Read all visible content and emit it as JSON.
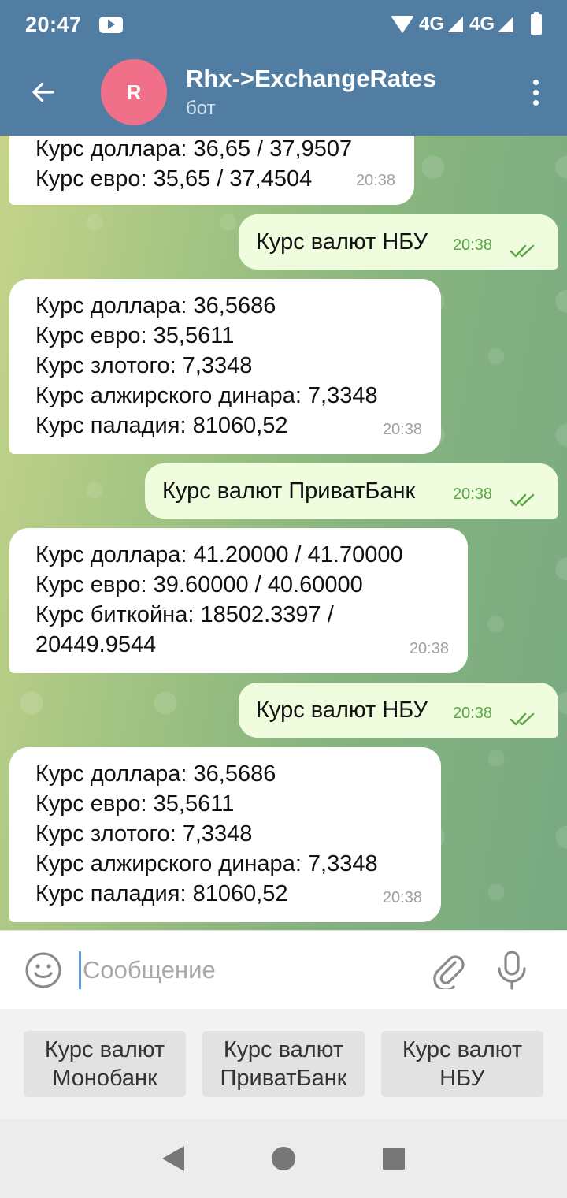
{
  "status_bar": {
    "time": "20:47",
    "network_1": "4G",
    "network_2": "4G",
    "icons": [
      "youtube-icon",
      "wifi-icon",
      "signal-icon",
      "battery-icon"
    ]
  },
  "header": {
    "avatar_letter": "R",
    "title": "Rhx->ExchangeRates",
    "subtitle": "бот",
    "avatar_color": "#f0708a",
    "bar_color": "#527da3"
  },
  "messages": [
    {
      "direction": "in",
      "lines": [
        "Курс доллара: 36,65 / 37,9507",
        "Курс евро: 35,65 / 37,4504"
      ],
      "time": "20:38"
    },
    {
      "direction": "out",
      "lines": [
        "Курс валют НБУ"
      ],
      "time": "20:38"
    },
    {
      "direction": "in",
      "lines": [
        "Курс доллара: 36,5686",
        "Курс евро: 35,5611",
        "Курс злотого: 7,3348",
        "Курс алжирского динара: 7,3348",
        "Курс паладия: 81060,52"
      ],
      "time": "20:38"
    },
    {
      "direction": "out",
      "lines": [
        "Курс валют ПриватБанк"
      ],
      "time": "20:38"
    },
    {
      "direction": "in",
      "lines": [
        "Курс доллара: 41.20000 / 41.70000",
        "Курс евро: 39.60000 / 40.60000",
        "Курс биткойна: 18502.3397 /",
        "20449.9544"
      ],
      "time": "20:38"
    },
    {
      "direction": "out",
      "lines": [
        "Курс валют НБУ"
      ],
      "time": "20:38"
    },
    {
      "direction": "in",
      "lines": [
        "Курс доллара: 36,5686",
        "Курс евро: 35,5611",
        "Курс злотого: 7,3348",
        "Курс алжирского динара: 7,3348",
        "Курс паладия: 81060,52"
      ],
      "time": "20:38"
    }
  ],
  "input": {
    "placeholder": "Сообщение",
    "value": ""
  },
  "keyboard": [
    {
      "line1": "Курс валют",
      "line2": "Монобанк"
    },
    {
      "line1": "Курс валют",
      "line2": "ПриватБанк"
    },
    {
      "line1": "Курс валют",
      "line2": "НБУ"
    }
  ]
}
